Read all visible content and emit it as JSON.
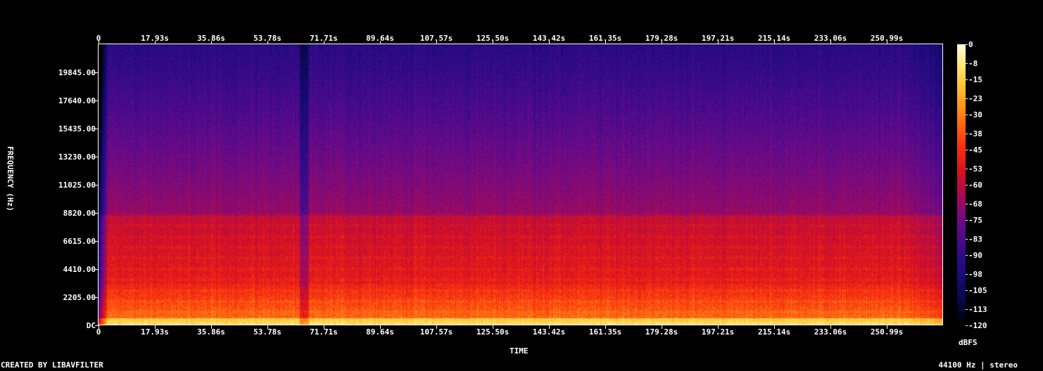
{
  "chart_data": {
    "type": "heatmap",
    "title": "",
    "xlabel": "TIME",
    "ylabel": "FREQUENCY (Hz)",
    "x_ticks": [
      "0",
      "17.93s",
      "35.86s",
      "53.78s",
      "71.71s",
      "89.64s",
      "107.57s",
      "125.50s",
      "143.42s",
      "161.35s",
      "179.28s",
      "197.21s",
      "215.14s",
      "233.06s",
      "250.99s"
    ],
    "x_tick_values": [
      0,
      17.93,
      35.86,
      53.78,
      71.71,
      89.64,
      107.57,
      125.5,
      143.42,
      161.35,
      179.28,
      197.21,
      215.14,
      233.06,
      250.99
    ],
    "xlim": [
      0,
      268.9
    ],
    "y_ticks": [
      "DC",
      "2205.00",
      "4410.00",
      "6615.00",
      "8820.00",
      "11025.00",
      "13230.00",
      "15435.00",
      "17640.00",
      "19845.00"
    ],
    "y_tick_values": [
      0,
      2205,
      4410,
      6615,
      8820,
      11025,
      13230,
      15435,
      17640,
      19845
    ],
    "ylim": [
      0,
      22050
    ],
    "colorbar": {
      "label": "dBFS",
      "ticks": [
        "0",
        "-8",
        "-15",
        "-23",
        "-30",
        "-38",
        "-45",
        "-53",
        "-60",
        "-68",
        "-75",
        "-83",
        "-90",
        "-98",
        "-105",
        "-113",
        "-120"
      ],
      "tick_values": [
        0,
        -8,
        -15,
        -23,
        -30,
        -38,
        -45,
        -53,
        -60,
        -68,
        -75,
        -83,
        -90,
        -98,
        -105,
        -113,
        -120
      ],
      "range": [
        -120,
        0
      ]
    },
    "colormap": [
      "#000000",
      "#06084a",
      "#1a0a7a",
      "#3a0a8a",
      "#6a0a8a",
      "#a00a5a",
      "#d8101e",
      "#f83010",
      "#ff7010",
      "#ffb020",
      "#ffe060",
      "#ffffd8"
    ]
  },
  "footer": {
    "left": "CREATED BY LIBAVFILTER",
    "right": "44100 Hz | stereo"
  }
}
